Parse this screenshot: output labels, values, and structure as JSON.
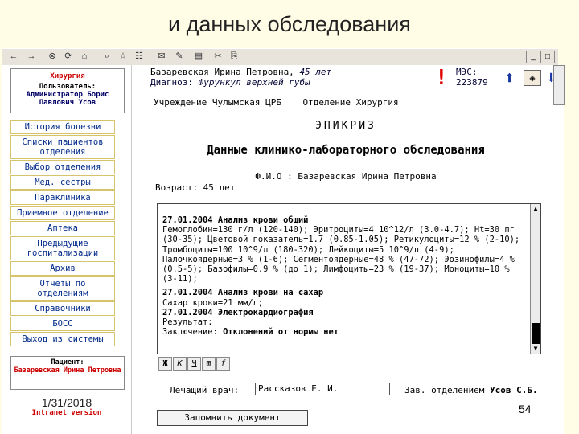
{
  "slide": {
    "title": "и данных обследования",
    "date": "1/31/2018",
    "page": "54"
  },
  "toolbar": {
    "icons": [
      "←",
      "→",
      "⊗",
      "⟳",
      "⌂",
      "⌕",
      "☆",
      "☷",
      "✉",
      "✎",
      "▤",
      "✂",
      "⎘"
    ],
    "win": [
      "_",
      "□",
      "×"
    ]
  },
  "user": {
    "app": "Хирургия",
    "label": "Пользователь:",
    "name": "Администратор Борис Павлович Усов"
  },
  "menu": [
    "История болезни",
    "Списки пациентов отделения",
    "Выбор отделения",
    "Мед. сестры",
    "Параклиника",
    "Приемное отделение",
    "Аптека",
    "Предыдущие госпитализации",
    "Архив",
    "Отчеты по отделениям",
    "Справочники",
    "БОСС",
    "Выход из системы"
  ],
  "patient": {
    "label": "Пациент:",
    "name": "Базаревская Ирина Петровна"
  },
  "footer": {
    "iv": "Intranet version"
  },
  "header": {
    "name": "Базаревская Ирина Петровна,",
    "age": "45 лет",
    "diag_label": "Диагноз:",
    "diag": "Фурункул верхней губы",
    "mes_label": "МЭС:",
    "mes": "223879",
    "warn": "!"
  },
  "inst": {
    "label1": "Учреждение",
    "val1": "Чулымская ЦРБ",
    "label2": "Отделение",
    "val2": "Хирургия"
  },
  "doc": {
    "epi": "ЭПИКРИЗ",
    "title": "Данные клинико-лабораторного обследования",
    "fio_label": "Ф.И.О :",
    "fio": "Базаревская Ирина Петровна",
    "age_label": "Возраст:",
    "age": "45 лет"
  },
  "text": {
    "h1": "27.01.2004 Анализ крови общий",
    "t1": "Гемоглобин=130 г/л (120-140); Эритроциты=4 10^12/л (3.0-4.7); Ht=30 пг (30-35); Цветовой показатель=1.7 (0.85-1.05); Ретикулоциты=12 % (2-10); Тромбоциты=100 10^9/л (180-320); Лейкоциты=5 10^9/л (4-9); Палочкоядерные=3 % (1-6); Сегментоядерные=48 % (47-72); Эозинофилы=4 % (0.5-5); Базофилы=0.9 % (до 1); Лимфоциты=23 % (19-37); Моноциты=10 % (3-11);",
    "h2": "27.01.2004 Анализ крови на сахар",
    "t2": "Сахар крови=21 мм/л;",
    "h3": "27.01.2004 Электрокардиография",
    "t3": "Результат:",
    "t4a": "Заключение:",
    "t4b": "Отклонений от нормы нет"
  },
  "fmt": [
    "Ж",
    "К",
    "Ч",
    "⊞",
    "f"
  ],
  "sign": {
    "doctor_label": "Лечащий врач:",
    "doctor": "Рассказов Е. И.",
    "chief_label": "Зав. отделением",
    "chief": "Усов С.Б."
  },
  "save": "Запомнить документ"
}
